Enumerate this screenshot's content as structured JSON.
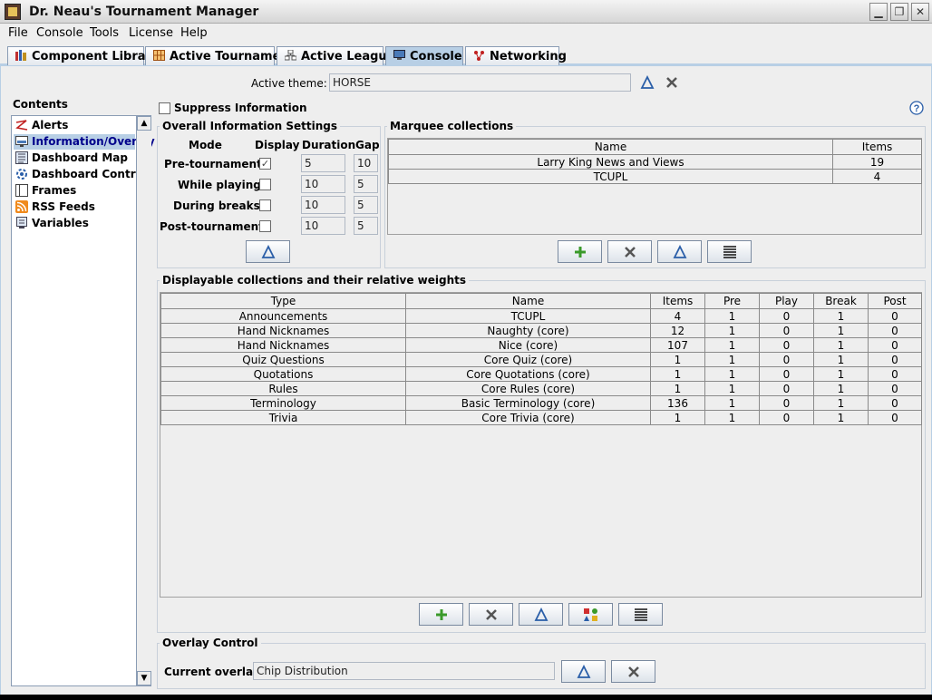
{
  "window": {
    "title": "Dr. Neau's Tournament Manager"
  },
  "menu": [
    "File",
    "Console",
    "Tools",
    "License",
    "Help"
  ],
  "tabs": [
    {
      "label": "Component Library",
      "icon": "books-icon"
    },
    {
      "label": "Active Tournament",
      "icon": "grid-icon"
    },
    {
      "label": "Active League",
      "icon": "league-icon"
    },
    {
      "label": "Console",
      "icon": "monitor-icon"
    },
    {
      "label": "Networking",
      "icon": "network-icon"
    }
  ],
  "active_theme": {
    "label": "Active theme:",
    "value": "HORSE"
  },
  "sidebar": {
    "title": "Contents",
    "items": [
      {
        "label": "Alerts",
        "icon": "alert-icon"
      },
      {
        "label": "Information/Overlay",
        "icon": "overlay-icon"
      },
      {
        "label": "Dashboard Map",
        "icon": "map-icon"
      },
      {
        "label": "Dashboard Control",
        "icon": "control-icon"
      },
      {
        "label": "Frames",
        "icon": "frame-icon"
      },
      {
        "label": "RSS Feeds",
        "icon": "rss-icon"
      },
      {
        "label": "Variables",
        "icon": "variables-icon"
      }
    ],
    "selected": "Information/Overlay"
  },
  "suppress": {
    "label": "Suppress Information",
    "checked": false
  },
  "overall": {
    "title": "Overall Information Settings",
    "headers": [
      "Mode",
      "Display",
      "Duration",
      "Gap"
    ],
    "rows": [
      {
        "mode": "Pre-tournament",
        "display": true,
        "duration": "5",
        "gap": "10"
      },
      {
        "mode": "While playing",
        "display": false,
        "duration": "10",
        "gap": "5"
      },
      {
        "mode": "During breaks",
        "display": false,
        "duration": "10",
        "gap": "5"
      },
      {
        "mode": "Post-tournament",
        "display": false,
        "duration": "10",
        "gap": "5"
      }
    ]
  },
  "marquee": {
    "title": "Marquee collections",
    "headers": [
      "Name",
      "Items"
    ],
    "rows": [
      {
        "name": "Larry King News and Views",
        "items": "19"
      },
      {
        "name": "TCUPL",
        "items": "4"
      }
    ]
  },
  "displayable": {
    "title": "Displayable collections and their relative weights",
    "headers": [
      "Type",
      "Name",
      "Items",
      "Pre",
      "Play",
      "Break",
      "Post"
    ],
    "rows": [
      [
        "Announcements",
        "TCUPL",
        "4",
        "1",
        "0",
        "1",
        "0"
      ],
      [
        "Hand Nicknames",
        "Naughty (core)",
        "12",
        "1",
        "0",
        "1",
        "0"
      ],
      [
        "Hand Nicknames",
        "Nice (core)",
        "107",
        "1",
        "0",
        "1",
        "0"
      ],
      [
        "Quiz Questions",
        "Core Quiz (core)",
        "1",
        "1",
        "0",
        "1",
        "0"
      ],
      [
        "Quotations",
        "Core Quotations (core)",
        "1",
        "1",
        "0",
        "1",
        "0"
      ],
      [
        "Rules",
        "Core Rules (core)",
        "1",
        "1",
        "0",
        "1",
        "0"
      ],
      [
        "Terminology",
        "Basic Terminology (core)",
        "136",
        "1",
        "0",
        "1",
        "0"
      ],
      [
        "Trivia",
        "Core Trivia (core)",
        "1",
        "1",
        "0",
        "1",
        "0"
      ]
    ]
  },
  "overlay": {
    "title": "Overlay Control",
    "label": "Current overlay:",
    "value": "Chip Distribution"
  },
  "colors": {
    "selection": "#b8cfe5",
    "panel": "#eeeeee",
    "accent": "#2a5ea8"
  }
}
